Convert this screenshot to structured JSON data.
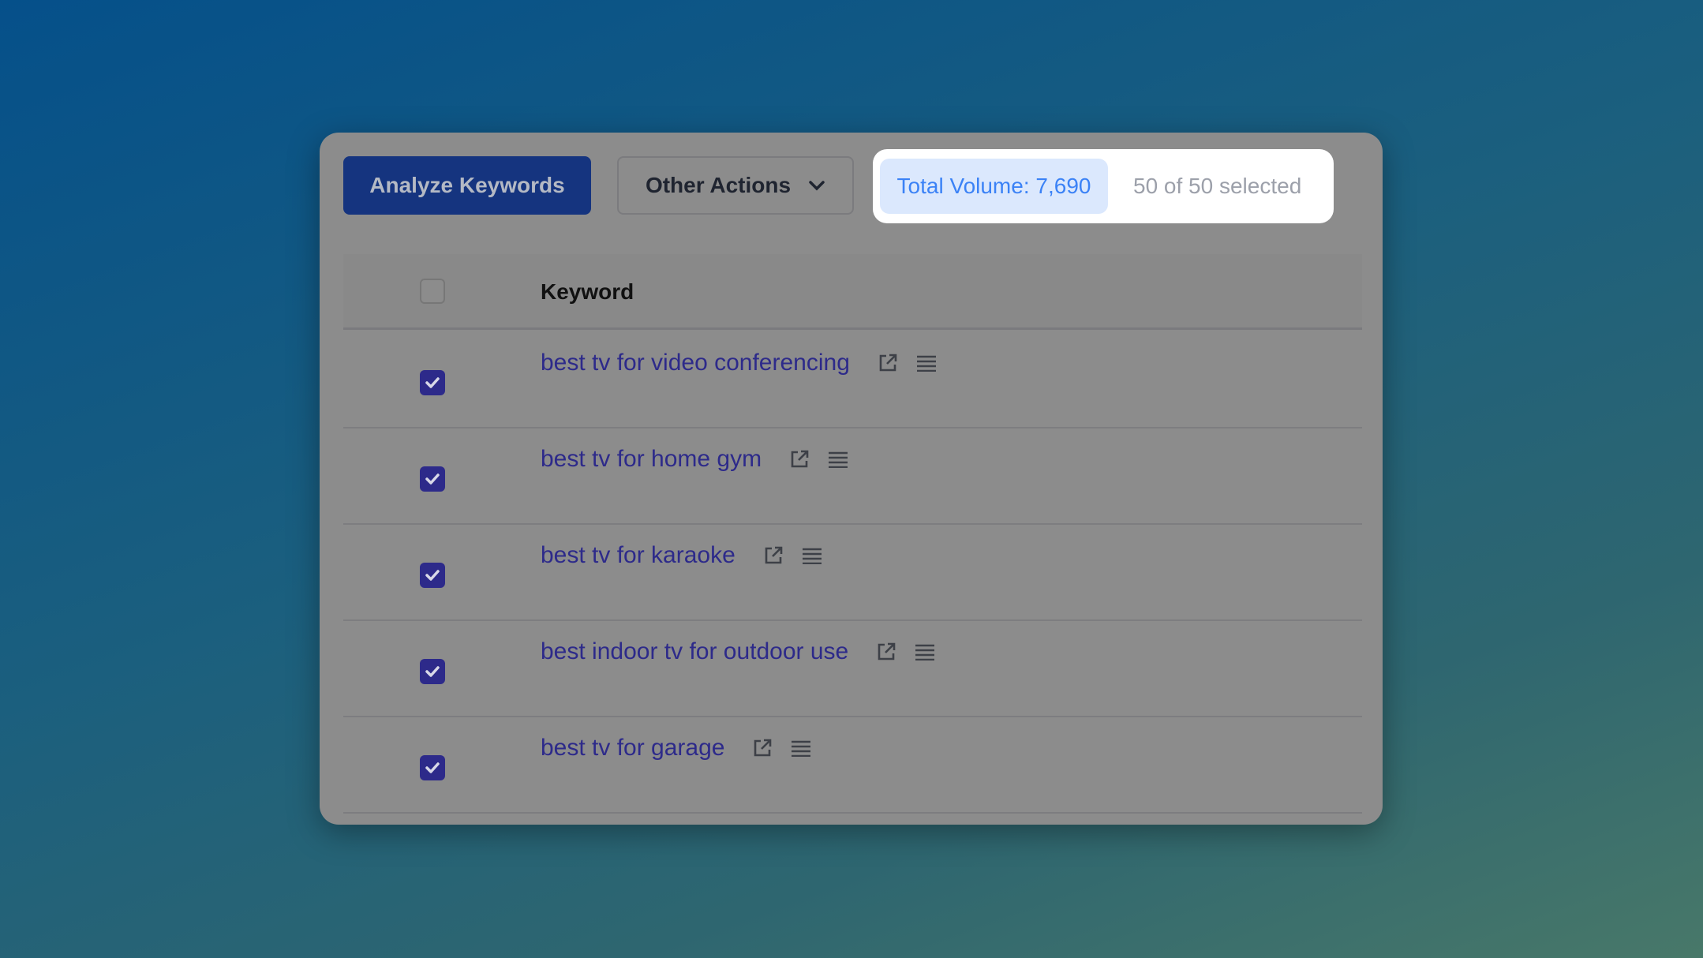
{
  "toolbar": {
    "analyze_label": "Analyze Keywords",
    "other_actions_label": "Other Actions",
    "total_volume": "Total Volume: 7,690",
    "selection": "50 of 50 selected"
  },
  "table": {
    "header": "Keyword",
    "select_all_checked": false,
    "rows": [
      {
        "keyword": "best tv for video conferencing",
        "checked": true
      },
      {
        "keyword": "best tv for home gym",
        "checked": true
      },
      {
        "keyword": "best tv for karaoke",
        "checked": true
      },
      {
        "keyword": "best indoor tv for outdoor use",
        "checked": true
      },
      {
        "keyword": "best tv for garage",
        "checked": true
      }
    ]
  },
  "colors": {
    "primary": "#15347f",
    "keyword_link": "#2d2a8a",
    "checkbox": "#2d2a8a",
    "volume_text": "#3b82f6",
    "volume_bg": "#dbe8fd"
  }
}
